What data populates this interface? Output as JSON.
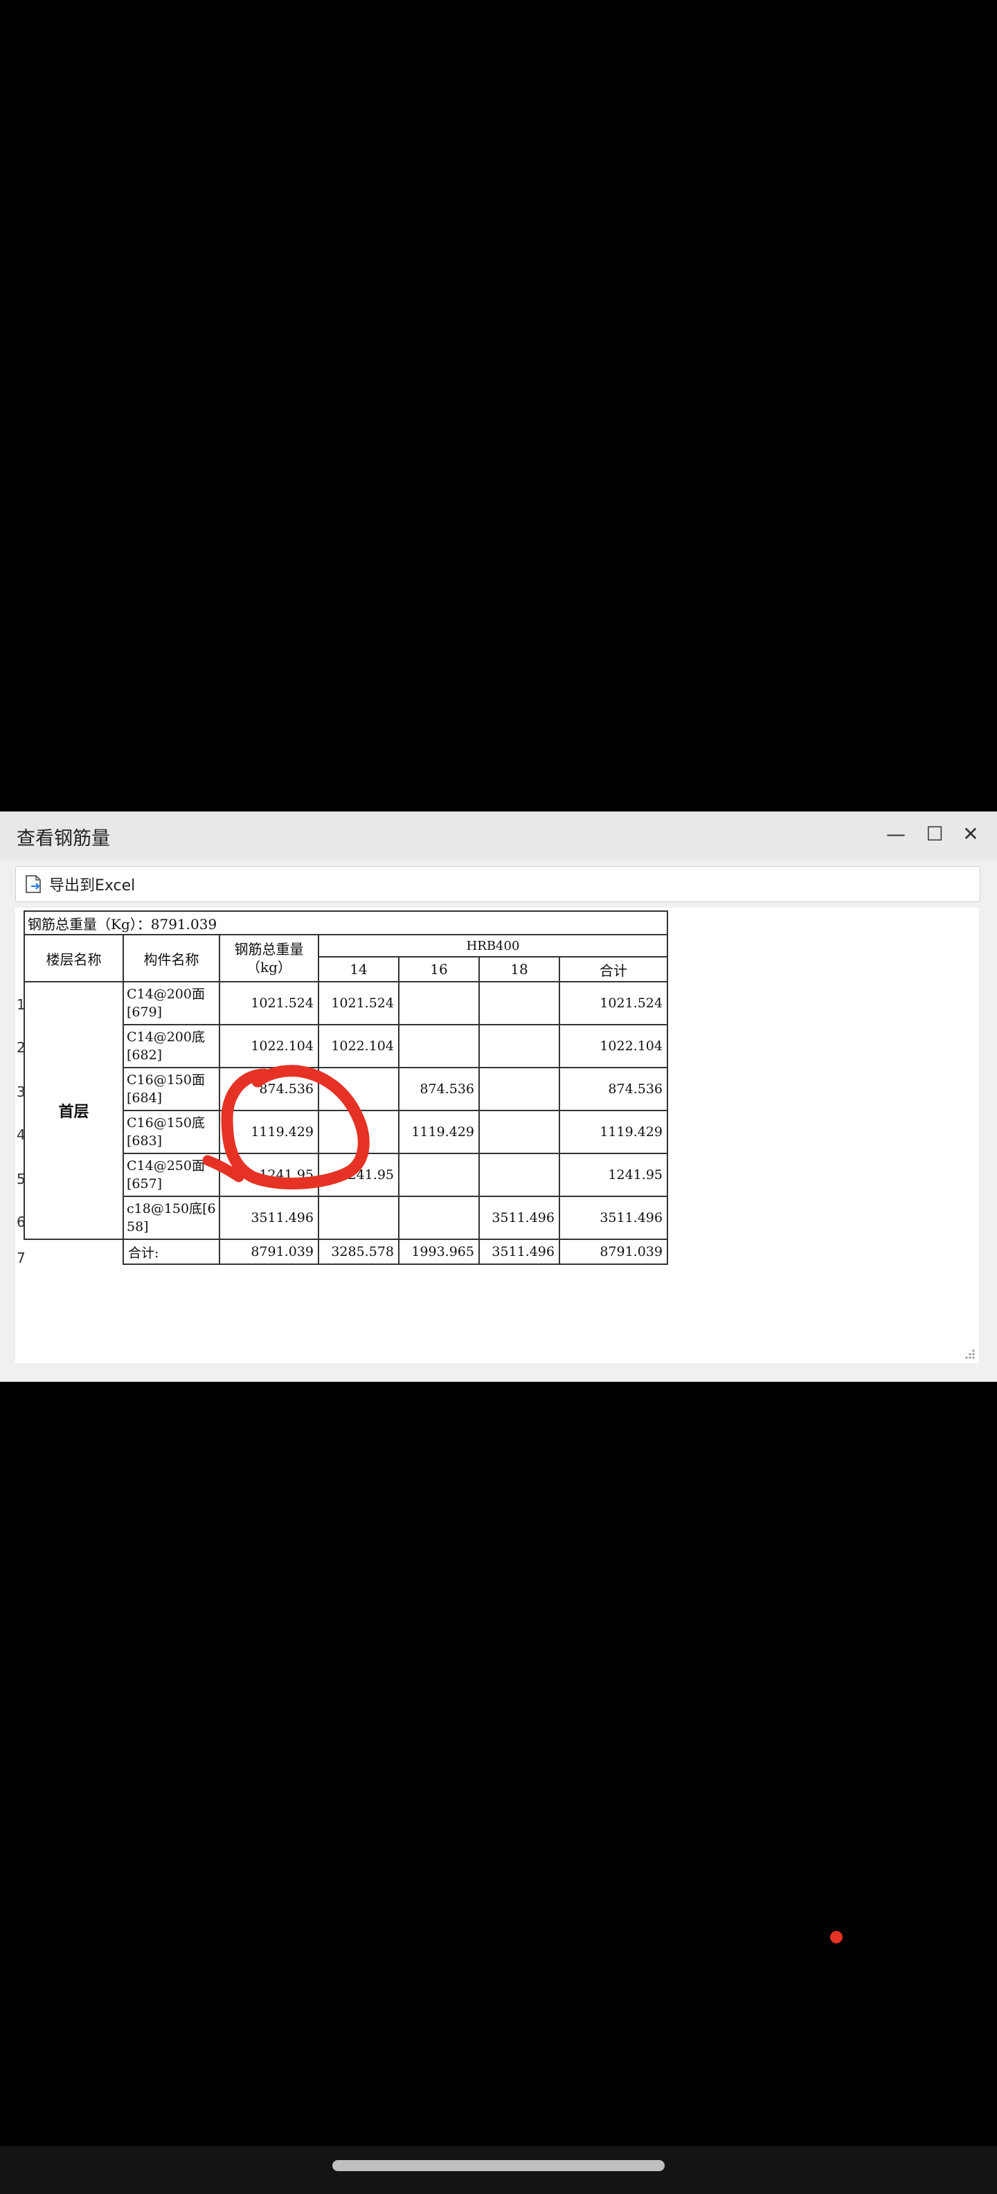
{
  "window": {
    "title": "查看钢筋量",
    "minimize_glyph": "—",
    "maximize_glyph": "☐",
    "close_glyph": "✕"
  },
  "toolbar": {
    "export_label": "导出到Excel",
    "export_icon": "export-excel-icon"
  },
  "table": {
    "total_weight_label": "钢筋总重量（Kg）：8791.039",
    "headers": {
      "floor": "楼层名称",
      "component": "构件名称",
      "total_weight": "钢筋总重量（kg）",
      "grade": "HRB400",
      "dia_14": "14",
      "dia_16": "16",
      "dia_18": "18",
      "subtotal": "合计"
    },
    "floor_name": "首层",
    "rows": [
      {
        "num": "1",
        "name": "C14@200面[679]",
        "weight": "1021.524",
        "d14": "1021.524",
        "d16": "",
        "d18": "",
        "sum": "1021.524"
      },
      {
        "num": "2",
        "name": "C14@200底[682]",
        "weight": "1022.104",
        "d14": "1022.104",
        "d16": "",
        "d18": "",
        "sum": "1022.104"
      },
      {
        "num": "3",
        "name": "C16@150面[684]",
        "weight": "874.536",
        "d14": "",
        "d16": "874.536",
        "d18": "",
        "sum": "874.536"
      },
      {
        "num": "4",
        "name": "C16@150底[683]",
        "weight": "1119.429",
        "d14": "",
        "d16": "1119.429",
        "d18": "",
        "sum": "1119.429"
      },
      {
        "num": "5",
        "name": "C14@250面[657]",
        "weight": "1241.95",
        "d14": "1241.95",
        "d16": "",
        "d18": "",
        "sum": "1241.95"
      },
      {
        "num": "6",
        "name": "c18@150底[658]",
        "weight": "3511.496",
        "d14": "",
        "d16": "",
        "d18": "3511.496",
        "sum": "3511.496"
      }
    ],
    "total_row": {
      "num": "7",
      "label": "合计:",
      "weight": "8791.039",
      "d14": "3285.578",
      "d16": "1993.965",
      "d18": "3511.496",
      "sum": "8791.039"
    }
  },
  "colors": {
    "annotation_red": "#e53224"
  }
}
